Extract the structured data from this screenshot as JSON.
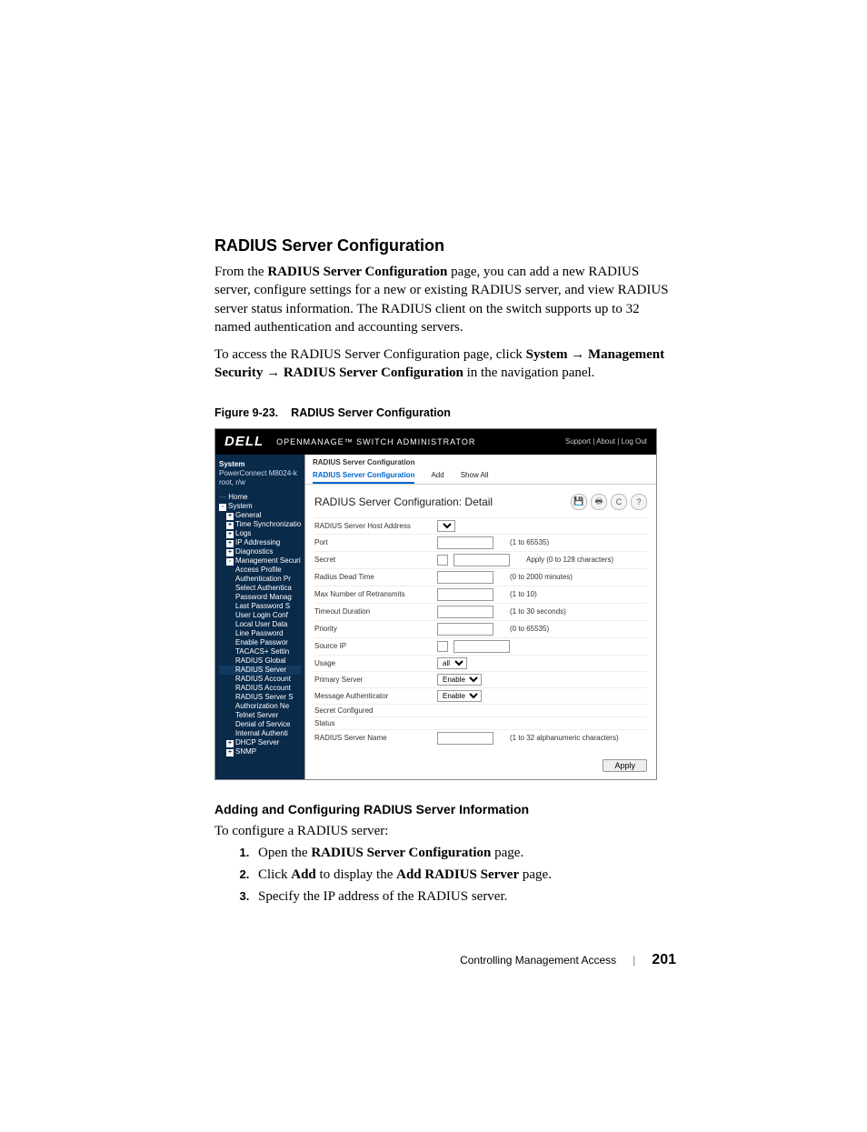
{
  "section_title": "RADIUS Server Configuration",
  "para1_pre": "From the ",
  "para1_bold": "RADIUS Server Configuration",
  "para1_post": " page, you can add a new RADIUS server, configure settings for a new or existing RADIUS server, and view RADIUS server status information. The RADIUS client on the switch supports up to 32 named authentication and accounting servers.",
  "para2_pre": "To access the RADIUS Server Configuration page, click ",
  "para2_nav1": "System",
  "para2_arrow": " → ",
  "para2_nav2": "Management Security",
  "para2_nav3": "RADIUS Server Configuration",
  "para2_post": " in the navigation panel.",
  "figure_label": "Figure 9-23.",
  "figure_title": "RADIUS Server Configuration",
  "screenshot": {
    "logo": "DELL",
    "app_title": "OPENMANAGE™ SWITCH ADMINISTRATOR",
    "top_links": "Support | About | Log Out",
    "side_header": "System",
    "side_device": "PowerConnect M8024-k",
    "side_user": "root, r/w",
    "nav": {
      "home": "Home",
      "system": "System",
      "general": "General",
      "timesync": "Time Synchronization",
      "logs": "Logs",
      "ipaddr": "IP Addressing",
      "diag": "Diagnostics",
      "mgmtsec": "Management Security",
      "items": [
        "Access Profile",
        "Authentication Pr",
        "Select Authentica",
        "Password Manag",
        "Last Password S",
        "User Login Conf",
        "Local User Data",
        "Line Password",
        "Enable Passwor",
        "TACACS+ Settin",
        "RADIUS Global",
        "RADIUS Server",
        "RADIUS Account",
        "RADIUS Account",
        "RADIUS Server S",
        "Authorization Ne",
        "Telnet Server",
        "Denial of Service",
        "Internal Authenti"
      ],
      "dhcp": "DHCP Server",
      "snmp": "SNMP"
    },
    "breadcrumb": "RADIUS Server Configuration",
    "tabs": {
      "t1": "RADIUS Server Configuration",
      "t2": "Add",
      "t3": "Show All"
    },
    "panel_title": "RADIUS Server Configuration: Detail",
    "icons": {
      "save": "💾",
      "print": "🖶",
      "refresh": "C",
      "help": "?"
    },
    "rows": [
      {
        "label": "RADIUS Server Host Address",
        "type": "select_blank"
      },
      {
        "label": "Port",
        "type": "input",
        "hint": "(1 to 65535)"
      },
      {
        "label": "Secret",
        "type": "checkbox",
        "hint": "Apply  (0 to 128 characters)"
      },
      {
        "label": "Radius Dead Time",
        "type": "input",
        "hint": "(0 to 2000 minutes)"
      },
      {
        "label": "Max Number of Retransmits",
        "type": "input",
        "hint": "(1 to 10)"
      },
      {
        "label": "Timeout Duration",
        "type": "input",
        "hint": "(1 to 30 seconds)"
      },
      {
        "label": "Priority",
        "type": "input",
        "hint": "(0 to 65535)"
      },
      {
        "label": "Source IP",
        "type": "iptext"
      },
      {
        "label": "Usage",
        "type": "select",
        "value": "all"
      },
      {
        "label": "Primary Server",
        "type": "select",
        "value": "Enable"
      },
      {
        "label": "Message Authenticator",
        "type": "select",
        "value": "Enable"
      },
      {
        "label": "Secret Configured",
        "type": "blank"
      },
      {
        "label": "Status",
        "type": "blank"
      },
      {
        "label": "RADIUS Server Name",
        "type": "input",
        "hint": "(1 to 32 alphanumeric characters)"
      }
    ],
    "apply": "Apply"
  },
  "sub_title": "Adding and Configuring RADIUS Server Information",
  "sub_intro": "To configure a RADIUS server:",
  "step1_pre": "Open the ",
  "step1_bold": "RADIUS Server Configuration",
  "step1_post": " page.",
  "step2_pre": "Click ",
  "step2_bold1": "Add",
  "step2_mid": " to display the ",
  "step2_bold2": "Add RADIUS Server",
  "step2_post": " page.",
  "step3": "Specify the IP address of the RADIUS server.",
  "footer_text": "Controlling Management Access",
  "page_number": "201"
}
